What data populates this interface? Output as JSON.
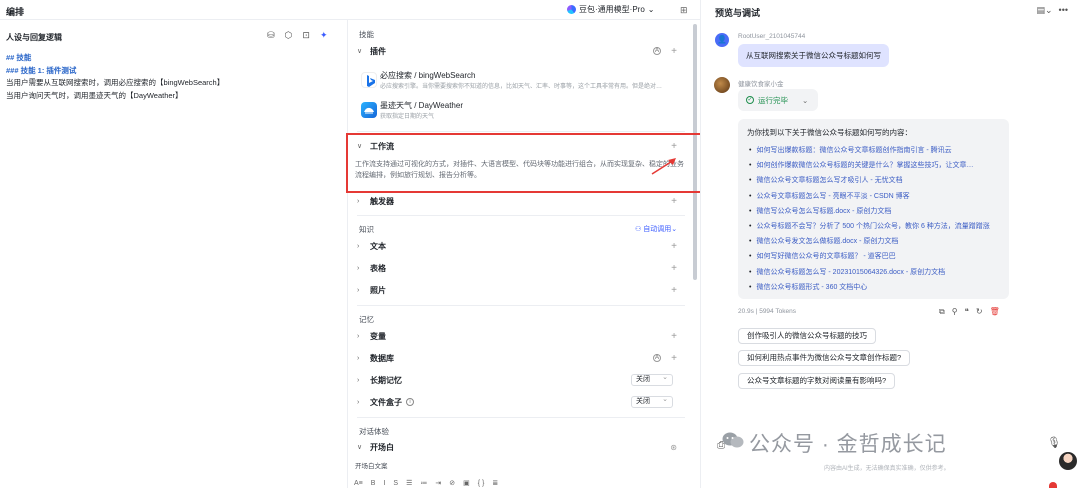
{
  "topbar": {
    "title": "编排",
    "model_label": "豆包·通用模型·Pro",
    "model_chevron": "⌄",
    "layout_icon": "⊞"
  },
  "prompt_panel": {
    "heading": "人设与回复逻辑",
    "lines": [
      {
        "text": "## 技能",
        "style": "h"
      },
      {
        "text": "### 技能 1: 插件测试",
        "style": "h"
      },
      {
        "text": "当用户需要从互联网搜索时，调用必应搜索的【bingWebSearch】",
        "style": "t"
      },
      {
        "text": "当用户询问天气时，调用墨迹天气的【DayWeather】",
        "style": "t"
      }
    ]
  },
  "skills": {
    "section_label": "技能",
    "plugins_label": "插件",
    "plugins": [
      {
        "name": "必应搜索 / bingWebSearch",
        "desc": "必应搜索引擎。当你需要搜索你不知道的信息，比如天气、汇率、时事等，这个工具非常有用。但是绝对…"
      },
      {
        "name": "墨迹天气 / DayWeather",
        "desc": "获取指定日期的天气"
      }
    ],
    "workflow_label": "工作流",
    "workflow_desc": "工作流支持通过可视化的方式，对插件、大语言模型、代码块等功能进行组合，从而实现复杂、稳定的业务流程编排，例如旅行规划、报告分析等。",
    "trigger_label": "触发器"
  },
  "knowledge": {
    "section_label": "知识",
    "auto_label": "自动调用",
    "items": [
      "文本",
      "表格",
      "照片"
    ]
  },
  "memory": {
    "section_label": "记忆",
    "variables": "变量",
    "database": "数据库",
    "long_term": "长期记忆",
    "long_term_value": "关闭",
    "file_box": "文件盒子",
    "file_box_value": "关闭"
  },
  "dialog": {
    "section_label": "对话体验",
    "opening": "开场白",
    "opening_text_label": "开场白文案",
    "toolbar": [
      "A≡",
      "B",
      "I",
      "S",
      "☰",
      "≔",
      "⇥",
      "⊘",
      "▣",
      "{ }",
      "≣"
    ]
  },
  "preview": {
    "title": "预览与调试",
    "user_name": "RootUser_2101045744",
    "user_msg": "从互联网搜索关于微信公众号标题如何写",
    "bot_name": "健康饮食家小金",
    "run_status": "运行完毕",
    "answer_intro": "为你找到以下关于微信公众号标题如何写的内容：",
    "links": [
      "如何写出爆款标题：微信公众号文章标题创作指南引言 - 腾讯云",
      "如何创作爆款微信公众号标题的关键是什么？掌握这些技巧，让文章…",
      "微信公众号文章标题怎么写才吸引人 - 无忧文档",
      "公众号文章标题怎么写 - 亮眼不平淡 - CSDN 博客",
      "微信写公众号怎么写标题.docx - 原创力文档",
      "公众号标题不会写？分析了 500 个热门公众号，教你 6 种方法，流量蹭蹭涨",
      "微信公众号发文怎么做标题.docx - 原创力文档",
      "如何写好微信公众号的文章标题？ - 道客巴巴",
      "微信公众号标题怎么写 - 20231015064326.docx - 原创力文档",
      "微信公众号标题形式 - 360 文档中心"
    ],
    "stats": "20.9s  |  5994 Tokens",
    "suggestions": [
      "创作吸引人的微信公众号标题的技巧",
      "如何利用热点事件为微信公众号文章创作标题?",
      "公众号文章标题的字数对阅读量有影响吗?"
    ],
    "input_placeholder": "发送消息",
    "disclaimer": "内容由AI生成，无法确保真实准确，仅供参考。",
    "watermark": "公众号 · 金哲成长记"
  }
}
